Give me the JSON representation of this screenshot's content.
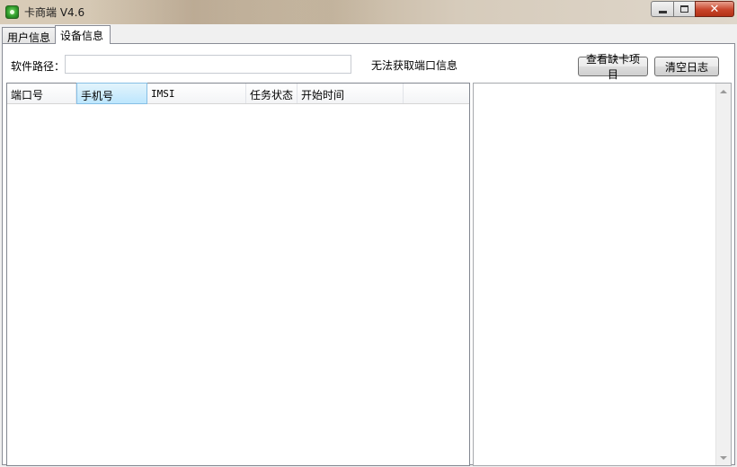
{
  "window": {
    "title": "卡商端 V4.6",
    "close_glyph": "✕"
  },
  "tabs": [
    {
      "label": "用户信息",
      "active": false
    },
    {
      "label": "设备信息",
      "active": true
    }
  ],
  "device": {
    "path_label": "软件路径：",
    "path_value": "",
    "port_status": "无法获取端口信息",
    "buttons": {
      "view_missing": "查看缺卡项目",
      "clear_log": "清空日志"
    }
  },
  "table": {
    "columns": [
      "端口号",
      "手机号",
      "IMSI",
      "任务状态",
      "开始时间",
      ""
    ],
    "rows": []
  },
  "icons": {
    "app": "app-green-icon",
    "minimize": "minimize-icon",
    "maximize": "maximize-icon",
    "close": "close-icon",
    "scroll_up": "scroll-up-arrow-icon",
    "scroll_down": "scroll-down-arrow-icon"
  }
}
